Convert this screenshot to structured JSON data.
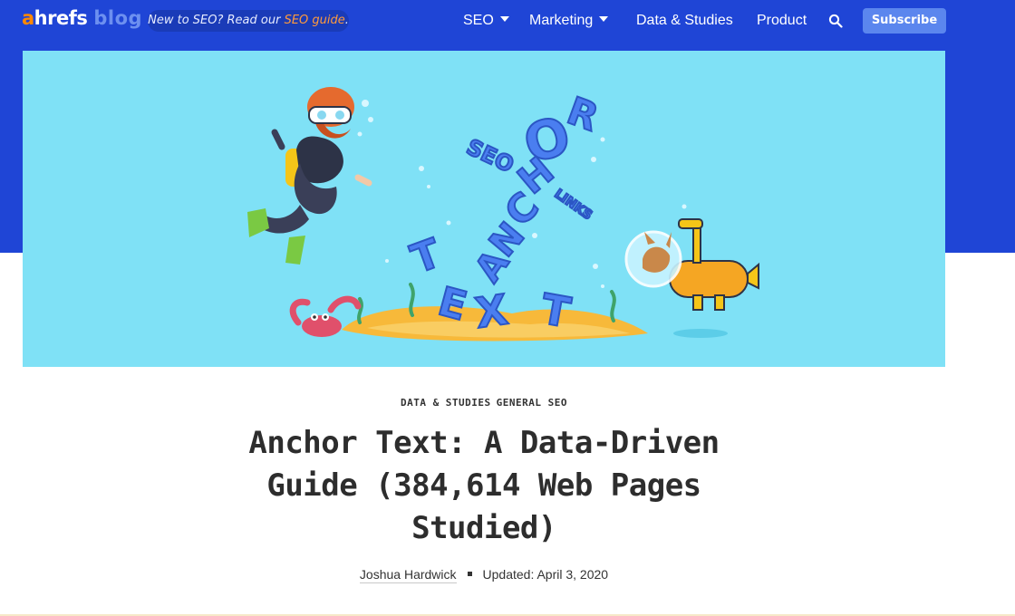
{
  "nav": {
    "logo_a": "a",
    "logo_hrefs": "hrefs",
    "logo_blog": "blog",
    "promo_text": "New to SEO? Read our ",
    "promo_link": "SEO guide",
    "promo_suffix": ".",
    "menu": [
      {
        "label": "SEO",
        "dropdown": true
      },
      {
        "label": "Marketing",
        "dropdown": true
      },
      {
        "label": "Data & Studies",
        "dropdown": false
      },
      {
        "label": "Product",
        "dropdown": false
      }
    ],
    "search_icon": "search-icon",
    "subscribe_label": "Subscribe"
  },
  "hero": {
    "letters_anchor": [
      "A",
      "N",
      "C",
      "H",
      "O",
      "R"
    ],
    "letters_text": [
      "T",
      "E",
      "X",
      "T"
    ],
    "word_seo": "SEO",
    "word_links": "LINKS"
  },
  "article": {
    "categories": [
      "DATA & STUDIES",
      "GENERAL SEO"
    ],
    "title": "Anchor Text: A Data-Driven Guide (384,614 Web Pages Studied)",
    "author": "Joshua Hardwick",
    "updated": "Updated: April 3, 2020"
  },
  "colors": {
    "header_blue": "#1f45d6",
    "hero_bg": "#7fe1f6",
    "accent_orange": "#ff8800",
    "subscribe_bg": "#5b86ee"
  }
}
